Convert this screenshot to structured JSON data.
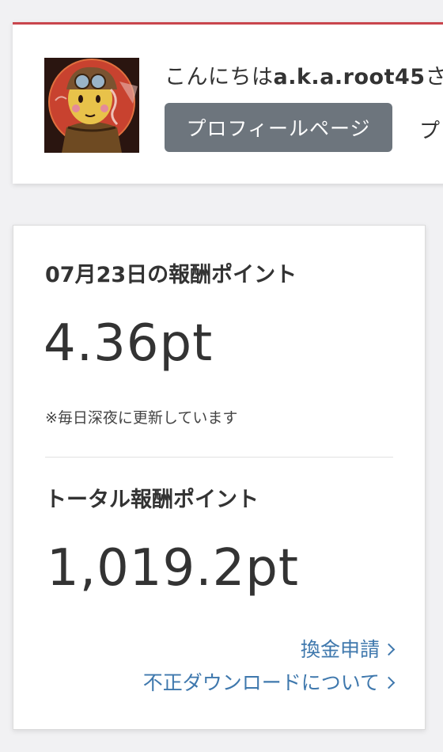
{
  "user": {
    "greeting_prefix": "こんにちは",
    "username": "a.k.a.root45",
    "greeting_suffix": "さん",
    "profile_button_label": "プロフィールページ",
    "second_link_label": "プ"
  },
  "daily": {
    "title": "07月23日の報酬ポイント",
    "value": "4.36pt",
    "note": "※毎日深夜に更新しています"
  },
  "total": {
    "title": "トータル報酬ポイント",
    "value": "1,019.2pt"
  },
  "links": {
    "exchange": "換金申請",
    "fraud": "不正ダウンロードについて"
  },
  "colors": {
    "accent_top_border": "#c9464d",
    "button_bg": "#6d757d",
    "link": "#3f78ad"
  }
}
